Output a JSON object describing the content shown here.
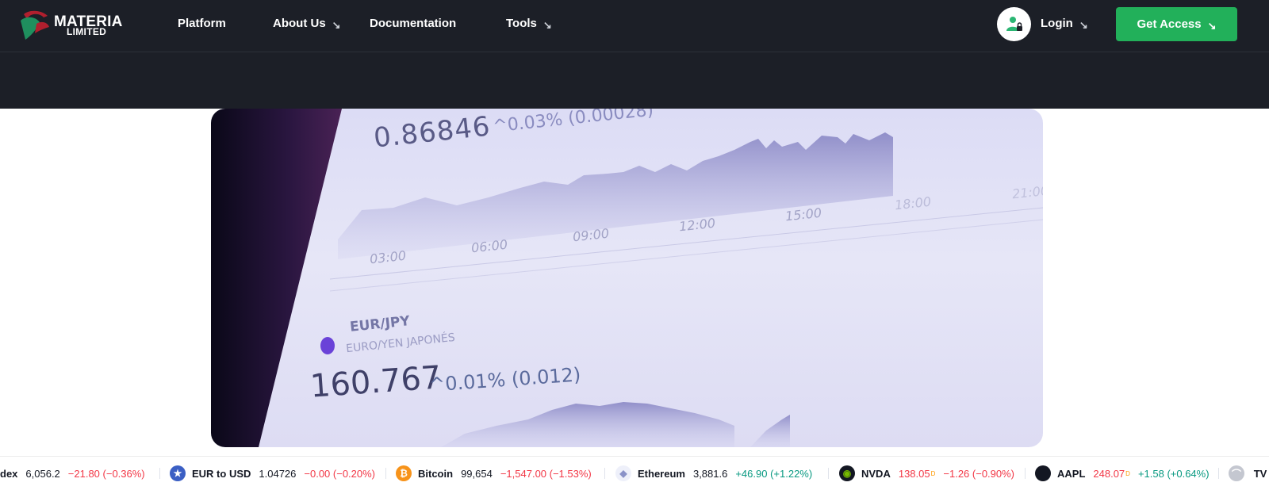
{
  "brand": {
    "name": "MATERIA",
    "sub": "LIMITED"
  },
  "nav": {
    "items": [
      {
        "label": "Platform",
        "has_arrow": false
      },
      {
        "label": "About Us",
        "has_arrow": true
      },
      {
        "label": "Documentation",
        "has_arrow": false
      },
      {
        "label": "Tools",
        "has_arrow": true
      }
    ],
    "login_label": "Login",
    "cta_label": "Get Access"
  },
  "colors": {
    "nav_bg": "#1c1f27",
    "cta": "#22b05a",
    "negative": "#f23645",
    "positive": "#089981"
  },
  "hero": {
    "rate_top": "0.86846",
    "change_top": "^0.03% (0.00028)",
    "times": [
      "03:00",
      "06:00",
      "09:00",
      "12:00",
      "15:00",
      "18:00",
      "21:00"
    ],
    "pair": "EUR/JPY",
    "pair_sub": "EURO/YEN JAPONÉS",
    "rate_bottom": "160.767",
    "change_bottom": "^0.01% (0.012)"
  },
  "ticker": [
    {
      "name": "dex",
      "price": "6,056.2",
      "change": "−21.80 (−0.36%)",
      "dir": "down",
      "icon": "none"
    },
    {
      "name": "EUR to USD",
      "price": "1.04726",
      "change": "−0.00 (−0.20%)",
      "dir": "down",
      "icon": "eu-us-flag-icon"
    },
    {
      "name": "Bitcoin",
      "price": "99,654",
      "change": "−1,547.00 (−1.53%)",
      "dir": "down",
      "icon": "bitcoin-icon"
    },
    {
      "name": "Ethereum",
      "price": "3,881.6",
      "change": "+46.90 (+1.22%)",
      "dir": "up",
      "icon": "ethereum-icon"
    },
    {
      "name": "NVDA",
      "price": "138.05",
      "price_sup": "D",
      "change": "−1.26 (−0.90%)",
      "dir": "down",
      "icon": "nvidia-icon"
    },
    {
      "name": "AAPL",
      "price": "248.07",
      "price_sup": "D",
      "change": "+1.58 (+0.64%)",
      "dir": "up",
      "icon": "apple-icon"
    }
  ]
}
